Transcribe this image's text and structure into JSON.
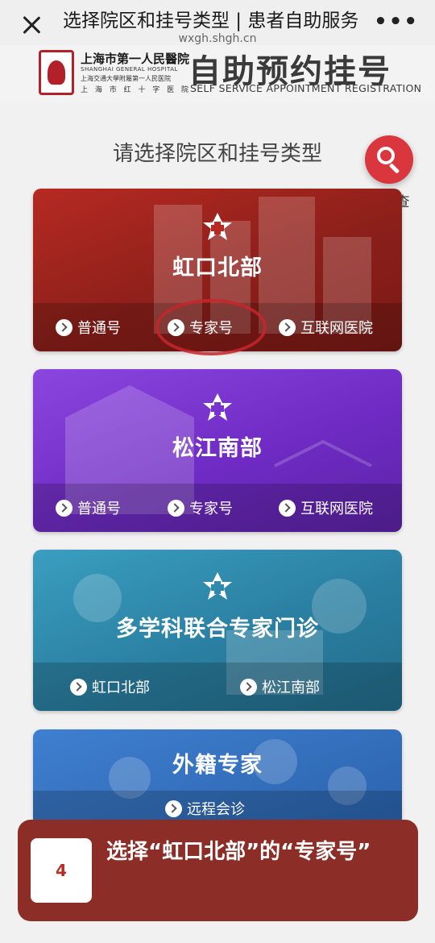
{
  "topbar": {
    "title": "选择院区和挂号类型 | 患者自助服务",
    "domain": "wxgh.shgh.cn",
    "more": "•••"
  },
  "header": {
    "hospital_name": "上海市第一人民醫院",
    "hospital_en": "SHANGHAI GENERAL HOSPITAL",
    "hospital_affil": "上海交通大學附屬第一人民医院",
    "hospital_red_cross": "上 海 市 红 十 字 医 院",
    "app_title": "自助预约挂号",
    "app_subtitle": "SELF SERVICE APPOINTMENT REGISTRATION"
  },
  "main": {
    "prompt": "请选择院区和挂号类型",
    "search_label": "查一查",
    "cards": [
      {
        "title": "虹口北部",
        "options": [
          "普通号",
          "专家号",
          "互联网医院"
        ]
      },
      {
        "title": "松江南部",
        "options": [
          "普通号",
          "专家号",
          "互联网医院"
        ]
      },
      {
        "title": "多学科联合专家门诊",
        "options": [
          "虹口北部",
          "松江南部"
        ]
      },
      {
        "title": "外籍专家",
        "options": [
          "远程会诊"
        ]
      }
    ]
  },
  "overlay": {
    "step_number": "4",
    "instruction": "选择“虹口北部”的“专家号”"
  },
  "colors": {
    "red_card": "#9e241d",
    "purple_card": "#7a33cc",
    "teal_card": "#2f8aad",
    "blue_card": "#3571bd",
    "accent": "#d9363e",
    "overlay": "#8c2e27"
  }
}
